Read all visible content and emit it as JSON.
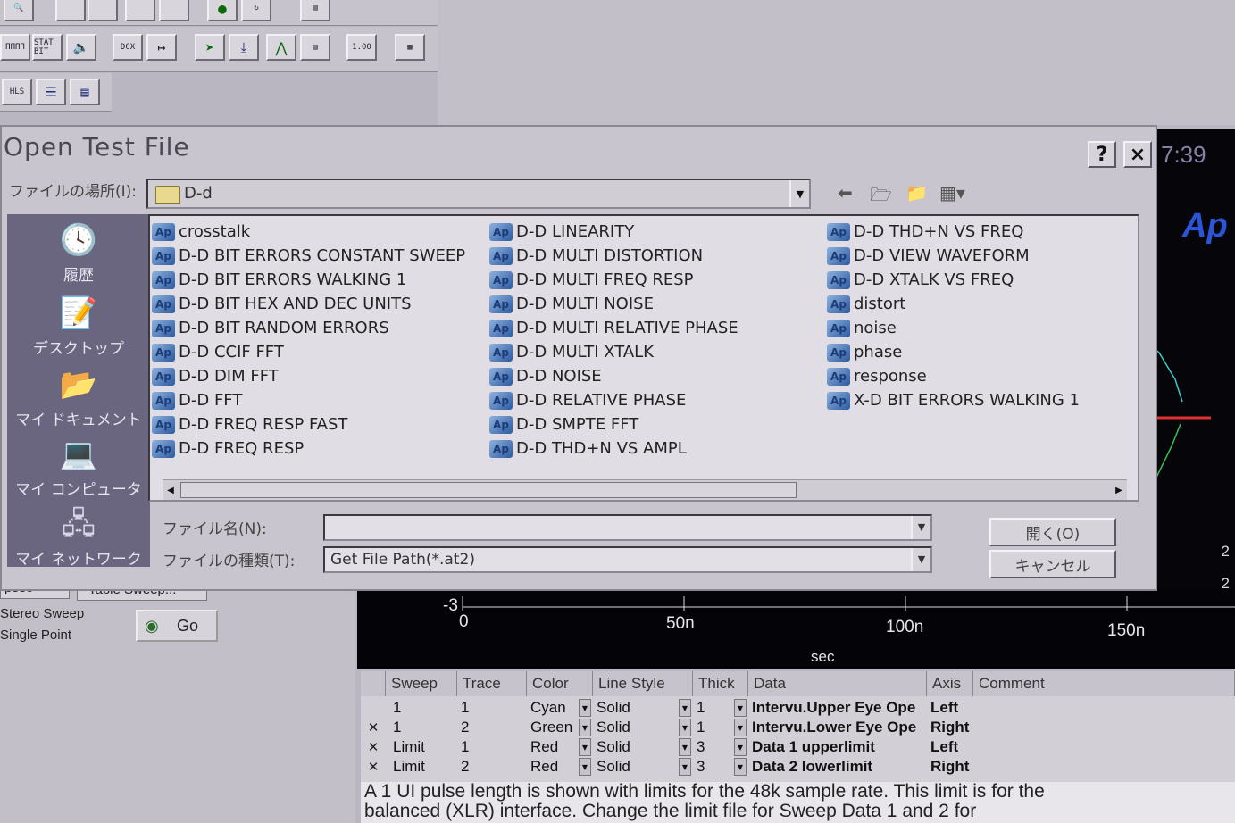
{
  "toolbar": {
    "row1": [
      "",
      "",
      "",
      "",
      "",
      "",
      "",
      ""
    ],
    "row2": [
      "ΠΠΠΠ",
      "STAT BIT",
      "",
      "DCX",
      "",
      "⇨",
      "",
      "",
      "",
      "1.00",
      ""
    ],
    "row3": [
      "HLS",
      "",
      ""
    ]
  },
  "right_panel": {
    "time": "7:39",
    "logo": "Ap",
    "axis_labels": [
      "2",
      "2",
      "-3"
    ]
  },
  "dialog": {
    "title": "Open Test File",
    "help_label": "?",
    "close_label": "×",
    "look_in_label": "ファイルの場所(I):",
    "look_in_value": "D-d",
    "places": [
      {
        "label": "履歴",
        "icon": "history-icon"
      },
      {
        "label": "デスクトップ",
        "icon": "desktop-icon"
      },
      {
        "label": "マイ ドキュメント",
        "icon": "my-documents-icon"
      },
      {
        "label": "マイ コンピュータ",
        "icon": "my-computer-icon"
      },
      {
        "label": "マイ ネットワーク",
        "icon": "my-network-icon"
      }
    ],
    "files": {
      "col1": [
        "crosstalk",
        "D-D BIT ERRORS CONSTANT SWEEP",
        "D-D BIT ERRORS WALKING 1",
        "D-D BIT HEX AND DEC UNITS",
        "D-D BIT RANDOM ERRORS",
        "D-D CCIF FFT",
        "D-D DIM FFT",
        "D-D FFT",
        "D-D FREQ RESP FAST",
        "D-D FREQ RESP"
      ],
      "col2": [
        "D-D LINEARITY",
        "D-D MULTI DISTORTION",
        "D-D MULTI FREQ RESP",
        "D-D MULTI NOISE",
        "D-D MULTI RELATIVE PHASE",
        "D-D MULTI XTALK",
        "D-D NOISE",
        "D-D RELATIVE PHASE",
        "D-D SMPTE FFT",
        "D-D THD+N VS AMPL"
      ],
      "col3": [
        "D-D THD+N VS FREQ",
        "D-D VIEW WAVEFORM",
        "D-D XTALK VS FREQ",
        "distort",
        "noise",
        "phase",
        "response",
        "X-D BIT ERRORS WALKING 1"
      ]
    },
    "file_icon_text": "Ap",
    "filename_label": "ファイル名(N):",
    "filename_value": "",
    "filetype_label": "ファイルの種類(T):",
    "filetype_value": "Get File Path(*.at2)",
    "open_button": "開く(O)",
    "cancel_button": "キャンセル"
  },
  "graph": {
    "y_label": "-3",
    "x_ticks": [
      "0",
      "50n",
      "100n",
      "150n"
    ],
    "x_label": "sec"
  },
  "lower_left": {
    "unit_value": "psec",
    "table_sweep_button": "Table Sweep...",
    "mode_line1": "Stereo Sweep",
    "mode_line2": "Single Point",
    "go_button": "Go"
  },
  "trace_table": {
    "headers": [
      "Sweep",
      "Trace",
      "Color",
      "Line Style",
      "Thick",
      "Data",
      "Axis",
      "Comment"
    ],
    "rows": [
      {
        "check": "",
        "sweep": "1",
        "trace": "1",
        "color": "Cyan",
        "style": "Solid",
        "thick": "1",
        "data": "Intervu.Upper Eye Ope",
        "axis": "Left"
      },
      {
        "check": "✕",
        "sweep": "1",
        "trace": "2",
        "color": "Green",
        "style": "Solid",
        "thick": "1",
        "data": "Intervu.Lower Eye Ope",
        "axis": "Right"
      },
      {
        "check": "✕",
        "sweep": "Limit",
        "trace": "1",
        "color": "Red",
        "style": "Solid",
        "thick": "3",
        "data": "Data 1 upperlimit",
        "axis": "Left"
      },
      {
        "check": "✕",
        "sweep": "Limit",
        "trace": "2",
        "color": "Red",
        "style": "Solid",
        "thick": "3",
        "data": "Data 2 lowerlimit",
        "axis": "Right"
      }
    ]
  },
  "comment": {
    "line1": "A 1 UI pulse length is shown with limits for the 48k sample rate. This limit is for the",
    "line2": "balanced (XLR) interface. Change the limit file for Sweep Data 1 and 2 for"
  }
}
